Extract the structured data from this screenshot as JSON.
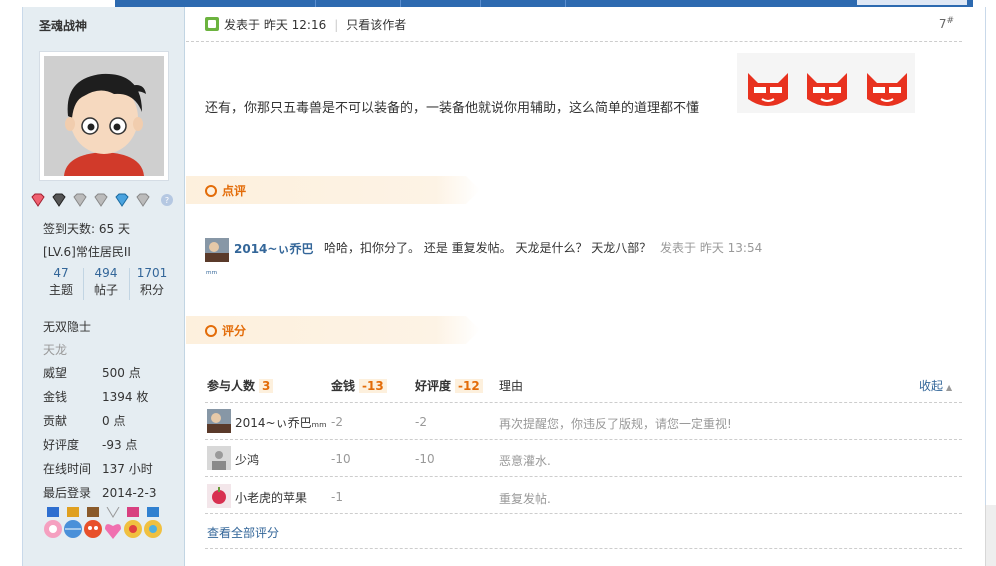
{
  "colors": {
    "link": "#336699",
    "accent": "#e36c09",
    "sidebar_bg": "#e5edf2",
    "section_bg": "#fdf0dd",
    "topbar": "#2d6ab0"
  },
  "sidebar": {
    "username": "圣魂战神",
    "checkin": "签到天数: 65 天",
    "level": "[LV.6]常住居民II",
    "stats": [
      {
        "num": "47",
        "label": "主题"
      },
      {
        "num": "494",
        "label": "帖子"
      },
      {
        "num": "1701",
        "label": "积分"
      }
    ],
    "title": "无双隐士",
    "subtitle": "天龙",
    "fields": [
      {
        "key": "威望",
        "value": "500 点"
      },
      {
        "key": "金钱",
        "value": "1394 枚"
      },
      {
        "key": "贡献",
        "value": "0 点"
      },
      {
        "key": "好评度",
        "value": "-93 点"
      },
      {
        "key": "在线时间",
        "value": "137 小时"
      },
      {
        "key": "最后登录",
        "value": "2014-2-3"
      }
    ],
    "medal_icons": [
      "heart-gem-icon",
      "gem-icon",
      "gem-icon",
      "gem-icon",
      "gem-icon",
      "gem-icon",
      "help-icon"
    ],
    "badge_icons": [
      "flower-badge-icon",
      "globe-badge-icon",
      "fox-badge-icon",
      "heart-badge-icon",
      "ribbon-badge-icon",
      "ribbon-badge-icon"
    ]
  },
  "post": {
    "posted_at": "发表于 昨天 12:16",
    "author_only": "只看该作者",
    "floor": "7",
    "floor_mark": "#",
    "text": "还有，你那只五毒兽是不可以装备的，一装备他就说你用辅助，这么简单的道理都不懂",
    "emoji_icons": [
      "fox-emoji-icon",
      "fox-emoji-icon",
      "fox-emoji-icon"
    ]
  },
  "comments": {
    "title": "点评",
    "items": [
      {
        "user": "2014~ぃ乔巴",
        "text": "哈哈，扣你分了。 还是 重复发帖。 天龙是什么？ 天龙八部？",
        "time": "发表于 昨天 13:54"
      }
    ],
    "more": "ᵐᵐ"
  },
  "ratings": {
    "title": "评分",
    "headers": {
      "participants": "参与人数",
      "participants_count": "3",
      "money": "金钱",
      "money_total": "-13",
      "reputation": "好评度",
      "reputation_total": "-12",
      "reason": "理由",
      "collapse": "收起"
    },
    "rows": [
      {
        "user": "2014~ぃ乔巴ₘₘ",
        "money": "-2",
        "reputation": "-2",
        "reason": "再次提醒您，你违反了版规，请您一定重视!"
      },
      {
        "user": "少鸿",
        "money": "-10",
        "reputation": "-10",
        "reason": "恶意灌水."
      },
      {
        "user": "小老虎的苹果",
        "money": "-1",
        "reputation": "",
        "reason": "重复发帖."
      }
    ],
    "view_all": "查看全部评分"
  }
}
